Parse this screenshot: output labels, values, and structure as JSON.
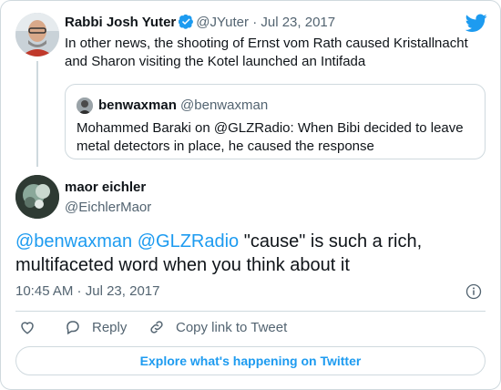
{
  "parent": {
    "name": "Rabbi Josh Yuter",
    "handle": "@JYuter",
    "date": "Jul 23, 2017",
    "text": "In other news, the shooting of Ernst vom Rath caused Kristallnacht and Sharon visiting the Kotel launched an Intifada",
    "quote": {
      "name": "benwaxman",
      "handle": "@benwaxman",
      "text": "Mohammed Baraki on @GLZRadio: When Bibi decided to leave metal detectors in place, he caused the response"
    }
  },
  "main": {
    "name": "maor eichler",
    "handle": "@EichlerMaor",
    "mention1": "@benwaxman",
    "mention2": "@GLZRadio",
    "text": "\"cause\" is such a rich, multifaceted word when you think about it",
    "time": "10:45 AM",
    "date": "Jul 23, 2017"
  },
  "actions": {
    "reply_label": "Reply",
    "copy_label": "Copy link to Tweet"
  },
  "explore_label": "Explore what's happening on Twitter",
  "icons": {
    "brand": "twitter-bird-icon",
    "verified": "verified-badge-icon",
    "info": "info-icon",
    "like": "heart-icon",
    "reply": "reply-bubble-icon",
    "copy": "link-icon"
  },
  "colors": {
    "accent": "#1d9bf0",
    "text": "#0f1419",
    "muted": "#536471",
    "border": "#cfd9de"
  }
}
